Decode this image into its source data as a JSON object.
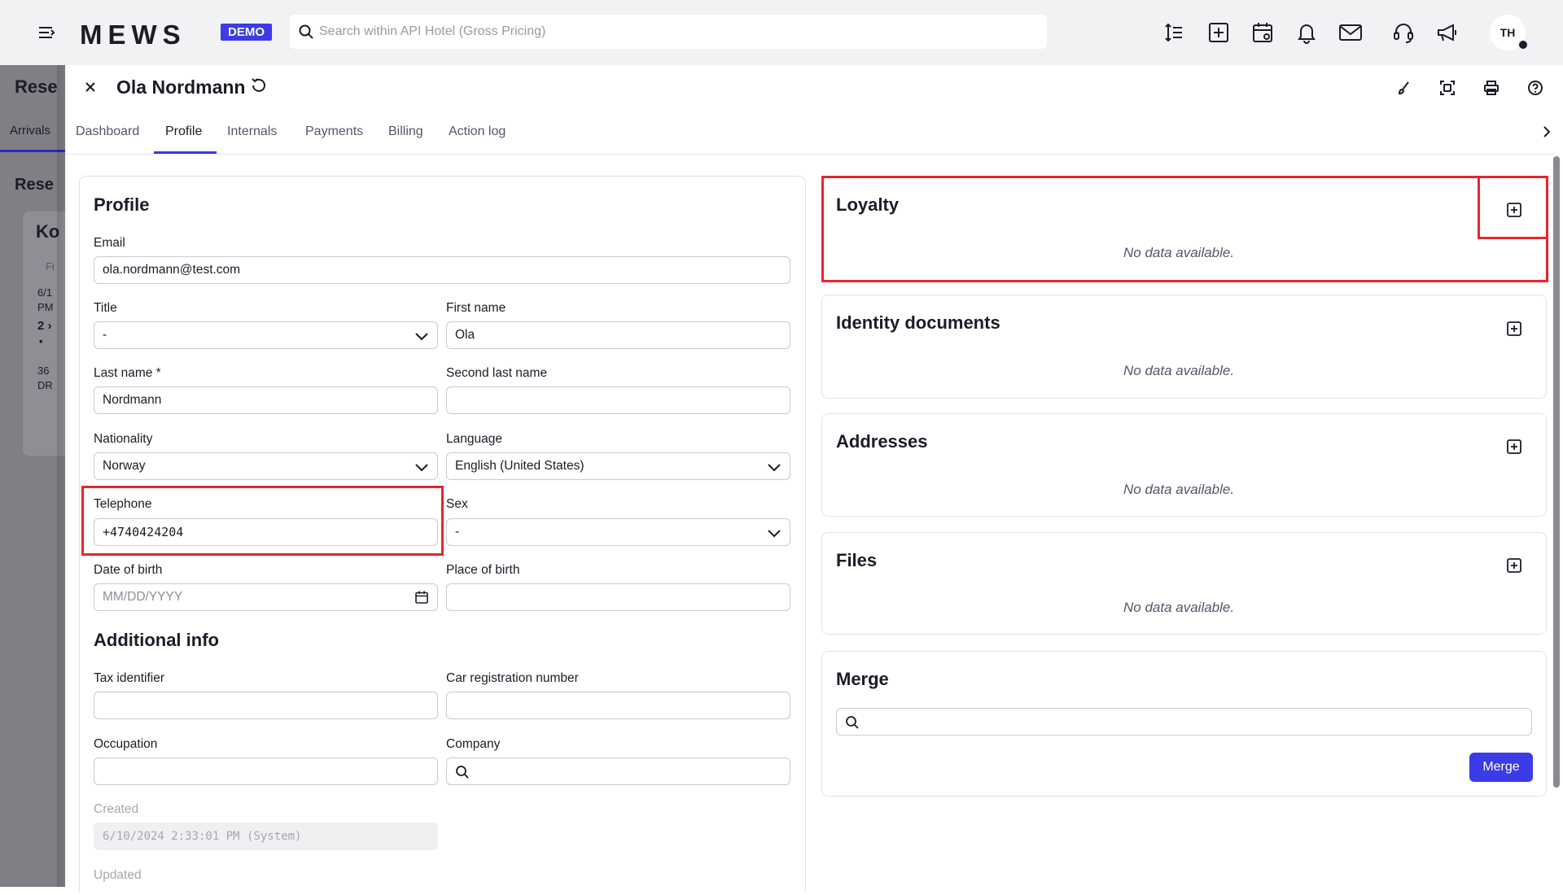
{
  "app": {
    "logo": "MEWS",
    "badge": "DEMO",
    "search_placeholder": "Search within API Hotel (Gross Pricing)",
    "avatar_initials": "TH",
    "icons": [
      "menu-icon",
      "line-spacing-icon",
      "add-box-icon",
      "calendar-icon",
      "bell-icon",
      "mail-icon",
      "headset-icon",
      "megaphone-icon"
    ]
  },
  "backdrop": {
    "title": "Rese",
    "tab": "Arrivals",
    "subtitle": "Rese",
    "card_title": "Ko",
    "card_lines": [
      "Fi",
      "6/1",
      "PM",
      "2 ›",
      "•",
      "36",
      "DR"
    ]
  },
  "panel": {
    "guest_name": "Ola Nordmann",
    "tabs": [
      "Dashboard",
      "Profile",
      "Internals",
      "Payments",
      "Billing",
      "Action log"
    ],
    "active_tab": "Profile"
  },
  "profile": {
    "title": "Profile",
    "email_label": "Email",
    "email_value": "ola.nordmann@test.com",
    "title_label": "Title",
    "title_value": "-",
    "first_name_label": "First name",
    "first_name_value": "Ola",
    "last_name_label": "Last name *",
    "last_name_value": "Nordmann",
    "second_last_name_label": "Second last name",
    "second_last_name_value": "",
    "nationality_label": "Nationality",
    "nationality_value": "Norway",
    "language_label": "Language",
    "language_value": "English (United States)",
    "telephone_label": "Telephone",
    "telephone_value": "+4740424204",
    "sex_label": "Sex",
    "sex_value": "-",
    "dob_label": "Date of birth",
    "dob_placeholder": "MM/DD/YYYY",
    "pob_label": "Place of birth",
    "pob_value": ""
  },
  "additional": {
    "title": "Additional info",
    "tax_label": "Tax identifier",
    "car_label": "Car registration number",
    "occupation_label": "Occupation",
    "company_label": "Company",
    "created_label": "Created",
    "created_value": "6/10/2024 2:33:01 PM (System)",
    "updated_label": "Updated"
  },
  "side": {
    "loyalty_title": "Loyalty",
    "identity_title": "Identity documents",
    "addresses_title": "Addresses",
    "files_title": "Files",
    "merge_title": "Merge",
    "no_data": "No data available.",
    "merge_button": "Merge"
  }
}
